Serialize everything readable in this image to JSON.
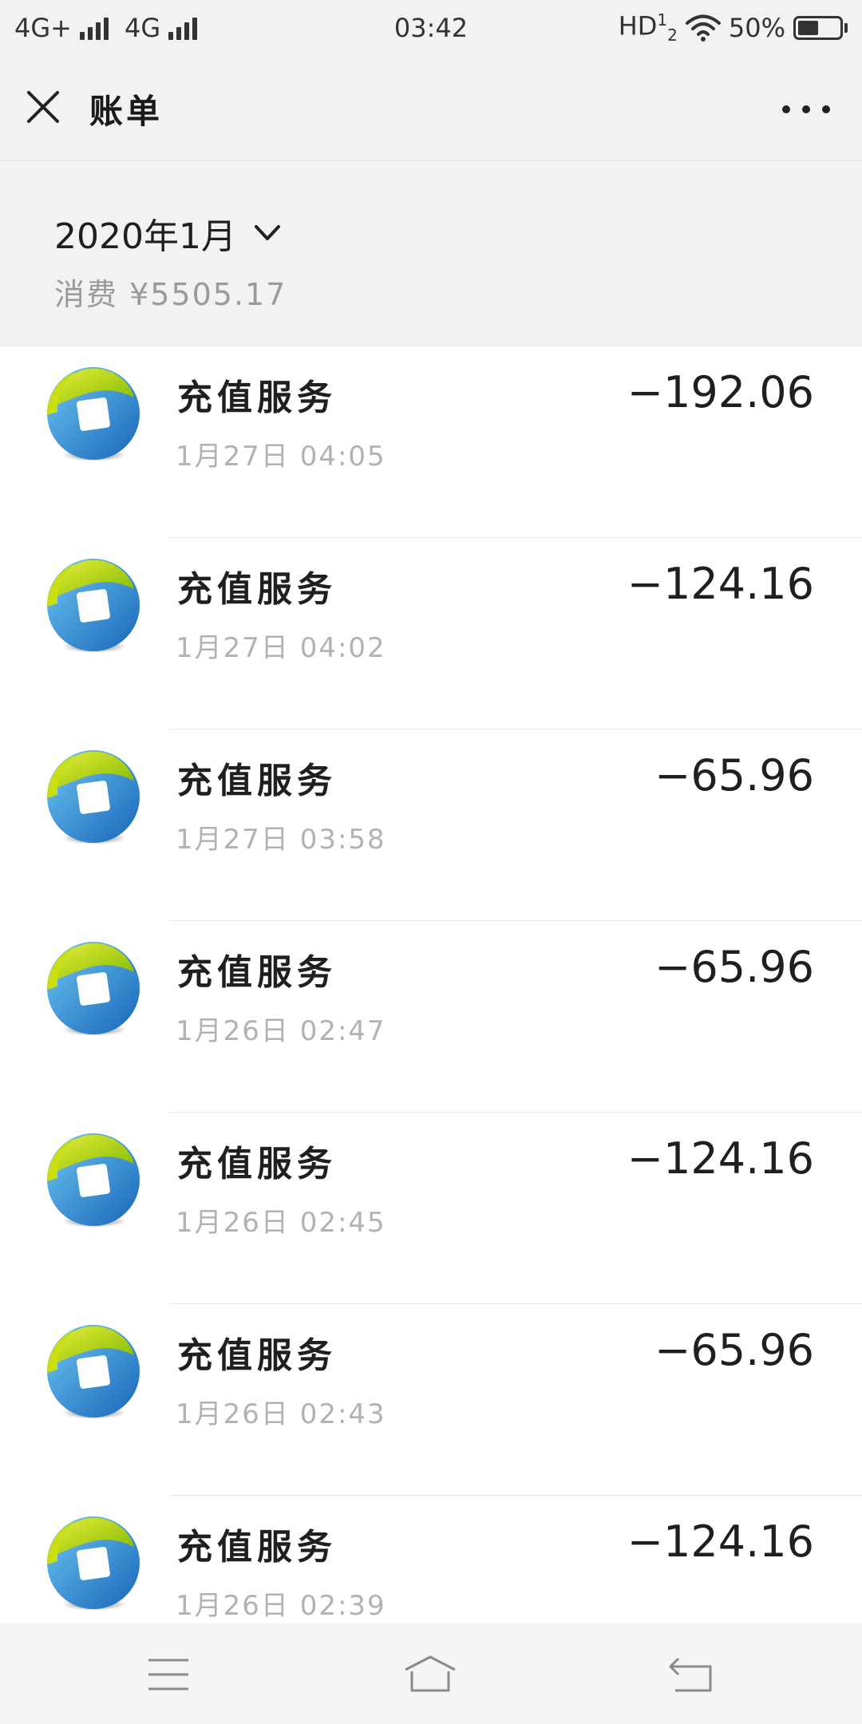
{
  "status_bar": {
    "network_1": "4G+",
    "network_2": "4G",
    "time": "03:42",
    "hd_label": "HD",
    "battery_text": "50%",
    "battery_level": 0.5
  },
  "title_bar": {
    "title": "账单"
  },
  "summary": {
    "month": "2020年1月",
    "total": "消费 ¥5505.17"
  },
  "transactions": [
    {
      "title": "充值服务",
      "time": "1月27日 04:05",
      "amount": "−192.06"
    },
    {
      "title": "充值服务",
      "time": "1月27日 04:02",
      "amount": "−124.16"
    },
    {
      "title": "充值服务",
      "time": "1月27日 03:58",
      "amount": "−65.96"
    },
    {
      "title": "充值服务",
      "time": "1月26日 02:47",
      "amount": "−65.96"
    },
    {
      "title": "充值服务",
      "time": "1月26日 02:45",
      "amount": "−124.16"
    },
    {
      "title": "充值服务",
      "time": "1月26日 02:43",
      "amount": "−65.96"
    },
    {
      "title": "充值服务",
      "time": "1月26日 02:39",
      "amount": "−124.16"
    }
  ],
  "icons": {
    "close": "close-icon",
    "more": "more-icon",
    "chevron": "chevron-down-icon",
    "app": "app-logo-icon",
    "nav_menu": "menu-icon",
    "nav_home": "home-icon",
    "nav_back": "back-icon"
  },
  "colors": {
    "background": "#f2f2f2",
    "list_background": "#ffffff",
    "secondary_text": "#9a9a9a",
    "logo_green": "#b8d400",
    "logo_blue": "#2a8fd6"
  }
}
